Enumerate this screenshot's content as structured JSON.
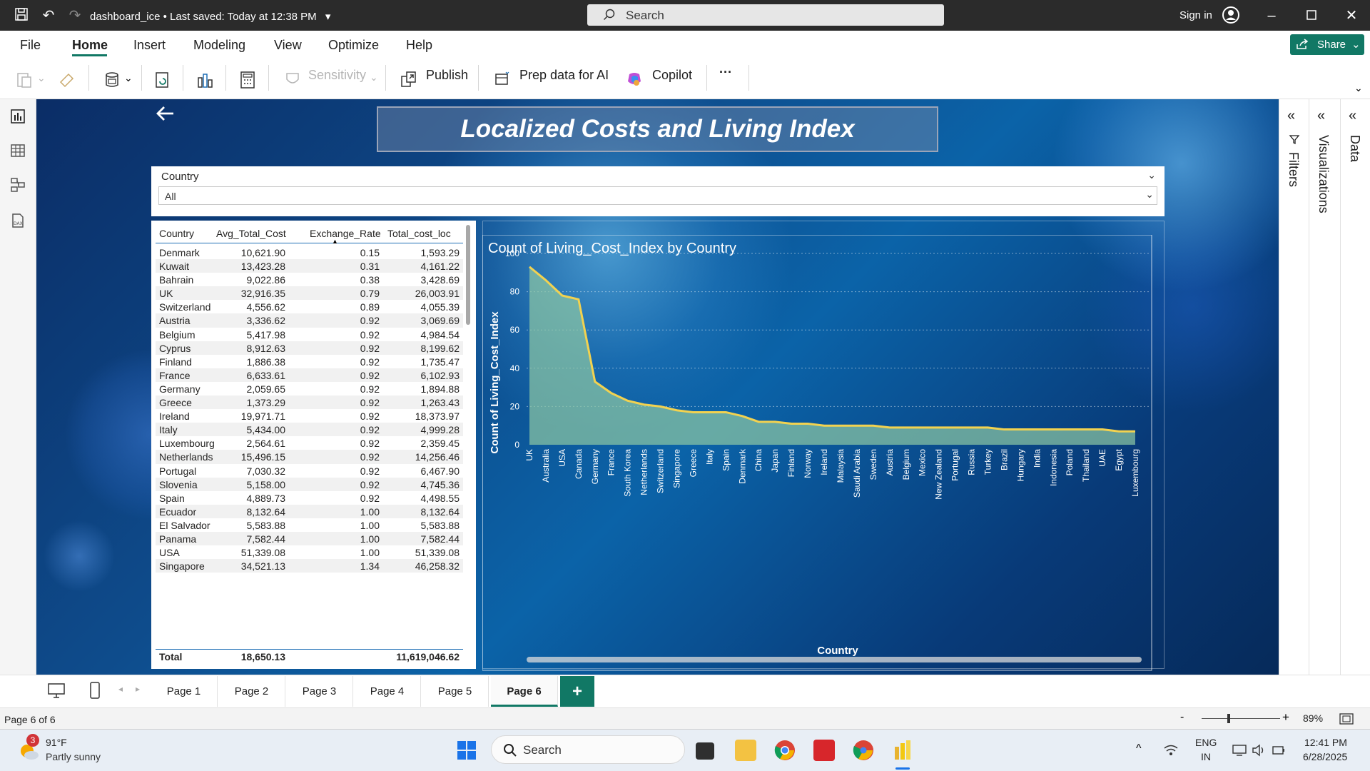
{
  "titlebar": {
    "doc_title": "dashboard_ice • Last saved: Today at 12:38 PM",
    "search_label": "Search",
    "sign_in": "Sign in"
  },
  "menu": [
    "File",
    "Home",
    "Insert",
    "Modeling",
    "View",
    "Optimize",
    "Help"
  ],
  "share_label": "Share",
  "ribbon": {
    "sensitivity": "Sensitivity",
    "publish": "Publish",
    "prep_data": "Prep data for AI",
    "copilot": "Copilot",
    "more": "···"
  },
  "report": {
    "title": "Localized Costs and Living Index",
    "slicer": {
      "label": "Country",
      "value": "All"
    },
    "table": {
      "headers": [
        "Country",
        "Avg_Total_Cost",
        "Exchange_Rate",
        "Total_cost_loc"
      ],
      "rows": [
        [
          "Denmark",
          "10,621.90",
          "0.15",
          "1,593.29"
        ],
        [
          "Kuwait",
          "13,423.28",
          "0.31",
          "4,161.22"
        ],
        [
          "Bahrain",
          "9,022.86",
          "0.38",
          "3,428.69"
        ],
        [
          "UK",
          "32,916.35",
          "0.79",
          "26,003.91"
        ],
        [
          "Switzerland",
          "4,556.62",
          "0.89",
          "4,055.39"
        ],
        [
          "Austria",
          "3,336.62",
          "0.92",
          "3,069.69"
        ],
        [
          "Belgium",
          "5,417.98",
          "0.92",
          "4,984.54"
        ],
        [
          "Cyprus",
          "8,912.63",
          "0.92",
          "8,199.62"
        ],
        [
          "Finland",
          "1,886.38",
          "0.92",
          "1,735.47"
        ],
        [
          "France",
          "6,633.61",
          "0.92",
          "6,102.93"
        ],
        [
          "Germany",
          "2,059.65",
          "0.92",
          "1,894.88"
        ],
        [
          "Greece",
          "1,373.29",
          "0.92",
          "1,263.43"
        ],
        [
          "Ireland",
          "19,971.71",
          "0.92",
          "18,373.97"
        ],
        [
          "Italy",
          "5,434.00",
          "0.92",
          "4,999.28"
        ],
        [
          "Luxembourg",
          "2,564.61",
          "0.92",
          "2,359.45"
        ],
        [
          "Netherlands",
          "15,496.15",
          "0.92",
          "14,256.46"
        ],
        [
          "Portugal",
          "7,030.32",
          "0.92",
          "6,467.90"
        ],
        [
          "Slovenia",
          "5,158.00",
          "0.92",
          "4,745.36"
        ],
        [
          "Spain",
          "4,889.73",
          "0.92",
          "4,498.55"
        ],
        [
          "Ecuador",
          "8,132.64",
          "1.00",
          "8,132.64"
        ],
        [
          "El Salvador",
          "5,583.88",
          "1.00",
          "5,583.88"
        ],
        [
          "Panama",
          "7,582.44",
          "1.00",
          "7,582.44"
        ],
        [
          "USA",
          "51,339.08",
          "1.00",
          "51,339.08"
        ],
        [
          "Singapore",
          "34,521.13",
          "1.34",
          "46,258.32"
        ]
      ],
      "total": [
        "Total",
        "18,650.13",
        "",
        "11,619,046.62"
      ]
    }
  },
  "chart_data": {
    "type": "area",
    "title": "Count of Living_Cost_Index by Country",
    "xlabel": "Country",
    "ylabel": "Count of Living_Cost_Index",
    "ylim": [
      0,
      100
    ],
    "yticks": [
      0,
      20,
      40,
      60,
      80,
      100
    ],
    "grid": true,
    "categories": [
      "UK",
      "Australia",
      "USA",
      "Canada",
      "Germany",
      "France",
      "South Korea",
      "Netherlands",
      "Switzerland",
      "Singapore",
      "Greece",
      "Italy",
      "Spain",
      "Denmark",
      "China",
      "Japan",
      "Finland",
      "Norway",
      "Ireland",
      "Malaysia",
      "Saudi Arabia",
      "Sweden",
      "Austria",
      "Belgium",
      "Mexico",
      "New Zealand",
      "Portugal",
      "Russia",
      "Turkey",
      "Brazil",
      "Hungary",
      "India",
      "Indonesia",
      "Poland",
      "Thailand",
      "UAE",
      "Egypt",
      "Luxembourg"
    ],
    "values": [
      93,
      86,
      78,
      76,
      33,
      27,
      23,
      21,
      20,
      18,
      17,
      17,
      17,
      15,
      12,
      12,
      11,
      11,
      10,
      10,
      10,
      10,
      9,
      9,
      9,
      9,
      9,
      9,
      9,
      8,
      8,
      8,
      8,
      8,
      8,
      8,
      7,
      7
    ],
    "colors": {
      "line": "#f2d250",
      "fill": "#8fc9a4"
    }
  },
  "panes": {
    "filters": "Filters",
    "visualizations": "Visualizations",
    "data": "Data"
  },
  "pages": [
    "Page 1",
    "Page 2",
    "Page 3",
    "Page 4",
    "Page 5",
    "Page 6"
  ],
  "active_page": "Page 6",
  "status": {
    "page_count": "Page 6 of 6",
    "zoom": "89%"
  },
  "taskbar": {
    "weather_temp": "91°F",
    "weather_desc": "Partly sunny",
    "weather_badge": "3",
    "search_label": "Search",
    "lang": "ENG",
    "region": "IN",
    "time": "12:41 PM",
    "date": "6/28/2025"
  }
}
